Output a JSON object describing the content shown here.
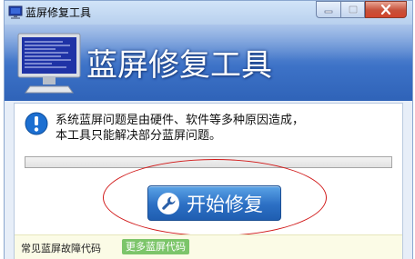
{
  "window": {
    "title": "蓝屏修复工具",
    "controls": {
      "minimize_icon": "minimize-icon",
      "maximize_icon": "maximize-icon",
      "close_icon": "close-icon"
    }
  },
  "banner": {
    "title": "蓝屏修复工具",
    "icon": "bsod-monitor-icon"
  },
  "info": {
    "icon": "info-icon",
    "line1": "系统蓝屏问题是由硬件、软件等多种原因造成，",
    "line2": "本工具只能解决部分蓝屏问题。"
  },
  "progress": {
    "value": 0
  },
  "start_button": {
    "label": "开始修复",
    "icon": "wrench-icon"
  },
  "footer": {
    "label": "常见蓝屏故障代码",
    "link": "更多蓝屏代码"
  },
  "colors": {
    "banner": "#3d72c7",
    "button": "#2c6fc4",
    "annotation": "#d11a1a",
    "link_bg": "#7cc56a"
  }
}
